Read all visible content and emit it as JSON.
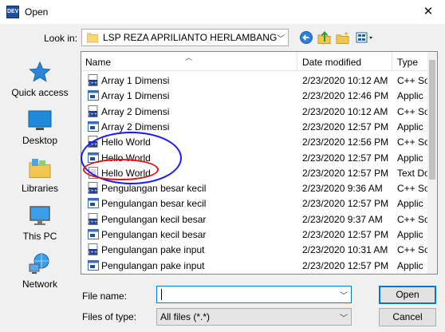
{
  "window": {
    "title": "Open",
    "icon_text": "DEV",
    "close_glyph": "✕"
  },
  "toolbar": {
    "lookin_label": "Look in:",
    "lookin_value": "LSP REZA APRILIANTO HERLAMBANG",
    "icons": [
      "back-icon",
      "up-folder-icon",
      "new-folder-icon",
      "view-menu-icon"
    ]
  },
  "places": [
    {
      "label": "Quick access",
      "icon": "quick-access-icon"
    },
    {
      "label": "Desktop",
      "icon": "desktop-icon"
    },
    {
      "label": "Libraries",
      "icon": "libraries-icon"
    },
    {
      "label": "This PC",
      "icon": "this-pc-icon"
    },
    {
      "label": "Network",
      "icon": "network-icon"
    }
  ],
  "columns": {
    "name": "Name",
    "date": "Date modified",
    "type": "Type"
  },
  "files": [
    {
      "name": "Array 1 Dimensi",
      "date": "2/23/2020 10:12 AM",
      "type": "C++ So",
      "icon": "cpp-source-icon"
    },
    {
      "name": "Array 1 Dimensi",
      "date": "2/23/2020 12:46 PM",
      "type": "Applic",
      "icon": "application-icon"
    },
    {
      "name": "Array 2 Dimensi",
      "date": "2/23/2020 10:12 AM",
      "type": "C++ So",
      "icon": "cpp-source-icon"
    },
    {
      "name": "Array 2 Dimensi",
      "date": "2/23/2020 12:57 PM",
      "type": "Applic",
      "icon": "application-icon"
    },
    {
      "name": "Hello World",
      "date": "2/23/2020 12:56 PM",
      "type": "C++ So",
      "icon": "cpp-source-icon"
    },
    {
      "name": "Hello World",
      "date": "2/23/2020 12:57 PM",
      "type": "Applic",
      "icon": "application-icon"
    },
    {
      "name": "Hello World",
      "date": "2/23/2020 12:57 PM",
      "type": "Text Do",
      "icon": "text-document-icon"
    },
    {
      "name": "Pengulangan besar kecil",
      "date": "2/23/2020 9:36 AM",
      "type": "C++ So",
      "icon": "cpp-source-icon"
    },
    {
      "name": "Pengulangan besar kecil",
      "date": "2/23/2020 12:57 PM",
      "type": "Applic",
      "icon": "application-icon"
    },
    {
      "name": "Pengulangan kecil besar",
      "date": "2/23/2020 9:37 AM",
      "type": "C++ So",
      "icon": "cpp-source-icon"
    },
    {
      "name": "Pengulangan kecil besar",
      "date": "2/23/2020 12:57 PM",
      "type": "Applic",
      "icon": "application-icon"
    },
    {
      "name": "Pengulangan pake input",
      "date": "2/23/2020 10:31 AM",
      "type": "C++ So",
      "icon": "cpp-source-icon"
    },
    {
      "name": "Pengulangan pake input",
      "date": "2/23/2020 12:57 PM",
      "type": "Applic",
      "icon": "application-icon"
    }
  ],
  "footer": {
    "filename_label": "File name:",
    "filename_value": "",
    "filetype_label": "Files of type:",
    "filetype_value": "All files (*.*)",
    "open_label": "Open",
    "cancel_label": "Cancel"
  },
  "colors": {
    "annotation_blue": "#1a1aff",
    "annotation_red": "#e01515",
    "focus_accent": "#0078d7"
  }
}
